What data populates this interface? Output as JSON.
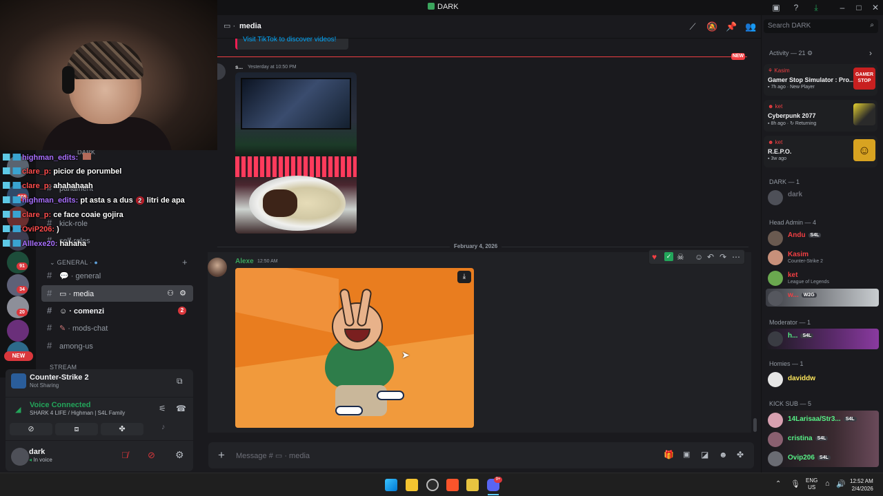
{
  "window": {
    "title": "DARK"
  },
  "header": {
    "channel": "media",
    "search_placeholder": "Search DARK"
  },
  "messages": {
    "tiktok_hint": "Visit TikTok to discover videos!",
    "new_label": "NEW",
    "msg1": {
      "author": "s...",
      "time": "Yesterday at 10:50 PM"
    },
    "date_divider": "February 4, 2026",
    "msg2": {
      "author": "Alexe",
      "time": "12:50 AM"
    },
    "composer_placeholder": "Message #",
    "composer_channel": "media"
  },
  "sidebar": {
    "server_name": "DARK",
    "rail_badges": [
      "506",
      "34",
      "91",
      "20",
      "NEW"
    ],
    "channels_top": [
      {
        "label": "parlament",
        "emoji": ""
      },
      {
        "label": "kick-role",
        "emoji": ""
      },
      {
        "label": "self-roles",
        "emoji": ""
      }
    ],
    "category_general": "GENERAL",
    "channels_general": [
      {
        "label": "general",
        "icon": "speech-icon"
      },
      {
        "label": "media",
        "icon": "film-icon"
      },
      {
        "label": "comenzi",
        "icon": "robot-icon",
        "badge": "2"
      },
      {
        "label": "mods-chat",
        "icon": "pencil-icon"
      },
      {
        "label": "among-us",
        "icon": ""
      }
    ],
    "category_stream": "STREAM"
  },
  "overlay_chat": [
    {
      "user": "highman_edits:",
      "msg": "",
      "color": "#a970ff"
    },
    {
      "user": "clare_p:",
      "msg": "picior de porumbel",
      "color": "#ff4d4d"
    },
    {
      "user": "clare_p:",
      "msg": "ahahahaah",
      "color": "#ff4d4d"
    },
    {
      "user": "highman_edits:",
      "msg": "pt asta s a dus",
      "extra_num": "2",
      "extra": "litri de apa",
      "color": "#a970ff"
    },
    {
      "user": "clare_p:",
      "msg": "ce face coaie gojira",
      "color": "#ff4d4d"
    },
    {
      "user": "OviP206:",
      "msg": ")",
      "color": "#ff4d4d"
    },
    {
      "user": "Alllexe20:",
      "msg": "hahaha",
      "color": "#a970ff"
    }
  ],
  "activity_panel": {
    "game": "Counter-Strike 2",
    "game_status": "Not Sharing",
    "voice_title": "Voice Connected",
    "voice_channel": "SHARK 4 LIFE / Highman | S4L Family"
  },
  "user": {
    "name": "dark",
    "status": "In voice"
  },
  "right_panel": {
    "activity_header": "Activity — 21",
    "activities": [
      {
        "user": "Kasim",
        "game": "Gamer Stop Simulator : Pro...",
        "time": "7h ago",
        "tag": "New Player",
        "user_color": "#f23f43"
      },
      {
        "user": "ket",
        "game": "Cyberpunk 2077",
        "time": "8h ago",
        "tag": "Returning",
        "user_color": "#f23f43"
      },
      {
        "user": "ket",
        "game": "R.E.P.O.",
        "time": "3w ago",
        "tag": "",
        "user_color": "#f23f43"
      }
    ],
    "sections": [
      {
        "title": "DARK — 1",
        "members": [
          {
            "name": "dark",
            "color": "#6d6f78",
            "sub": ""
          }
        ]
      },
      {
        "title": "Head Admin — 4",
        "members": [
          {
            "name": "Andu",
            "color": "#f23f43",
            "sub": "",
            "tag": "S4L"
          },
          {
            "name": "Kasim",
            "color": "#f23f43",
            "sub": "Counter-Strike 2"
          },
          {
            "name": "ket",
            "color": "#f23f43",
            "sub": "League of Legends"
          },
          {
            "name": "w...",
            "color": "#f23f43",
            "sub": "",
            "tag": "W2G"
          }
        ]
      },
      {
        "title": "Moderator — 1",
        "members": [
          {
            "name": "h...",
            "color": "#57f287",
            "sub": "",
            "tag": "S4L"
          }
        ]
      },
      {
        "title": "Homies — 1",
        "members": [
          {
            "name": "daviddw",
            "color": "#fee75c",
            "sub": ""
          }
        ]
      },
      {
        "title": "KICK SUB — 5",
        "members": [
          {
            "name": "14Larisaa/Str3...",
            "color": "#57f287",
            "sub": "",
            "tag": "S4L"
          },
          {
            "name": "cristina",
            "color": "#57f287",
            "sub": "",
            "tag": "S4L"
          },
          {
            "name": "Ovip206",
            "color": "#57f287",
            "sub": "",
            "tag": "S4L"
          }
        ]
      }
    ]
  },
  "taskbar": {
    "lang1": "ENG",
    "lang2": "US",
    "time": "12:52 AM",
    "date": "2/4/2026",
    "discord_badge": "9+"
  },
  "colors": {
    "accent": "#5865f2",
    "danger": "#da373c",
    "online": "#23a55a",
    "image_bg": "#e97d1f"
  }
}
